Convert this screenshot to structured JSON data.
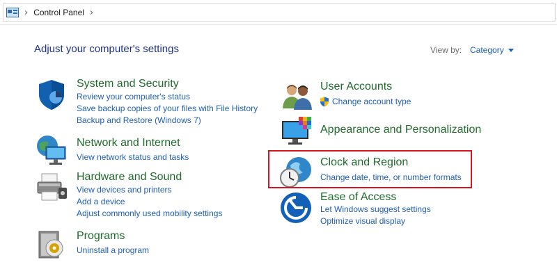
{
  "address_bar": {
    "crumbs": [
      "Control Panel"
    ]
  },
  "header": {
    "title": "Adjust your computer's settings",
    "view_by_label": "View by:",
    "view_by_value": "Category"
  },
  "categories": [
    {
      "icon": "shield-icon",
      "title": "System and Security",
      "links": [
        "Review your computer's status",
        "Save backup copies of your files with File History",
        "Backup and Restore (Windows 7)"
      ]
    },
    {
      "icon": "network-globe-icon",
      "title": "Network and Internet",
      "links": [
        "View network status and tasks"
      ]
    },
    {
      "icon": "printer-icon",
      "title": "Hardware and Sound",
      "links": [
        "View devices and printers",
        "Add a device",
        "Adjust commonly used mobility settings"
      ]
    },
    {
      "icon": "programs-disc-icon",
      "title": "Programs",
      "links": [
        "Uninstall a program"
      ]
    },
    {
      "icon": "users-icon",
      "title": "User Accounts",
      "links": [
        "Change account type"
      ]
    },
    {
      "icon": "monitor-palette-icon",
      "title": "Appearance and Personalization",
      "links": []
    },
    {
      "icon": "clock-globe-icon",
      "title": "Clock and Region",
      "links": [
        "Change date, time, or number formats"
      ]
    },
    {
      "icon": "ease-of-access-icon",
      "title": "Ease of Access",
      "links": [
        "Let Windows suggest settings",
        "Optimize visual display"
      ]
    }
  ],
  "colors": {
    "heading": "#1e3287",
    "category_title": "#1e6b2b",
    "link": "#1e5fb4",
    "highlight": "#d9141e"
  }
}
